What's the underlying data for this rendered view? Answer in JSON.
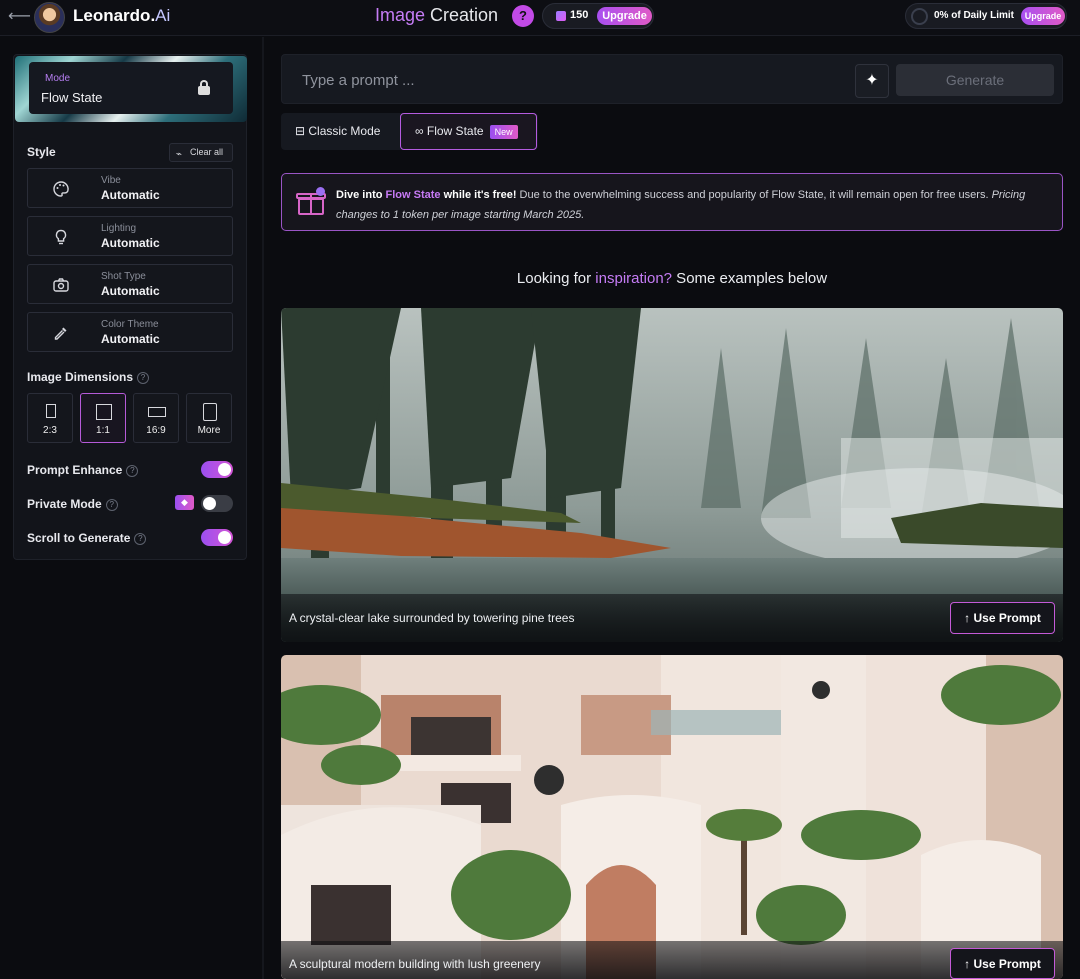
{
  "header": {
    "back_glyph": "⟵",
    "logo_main": "Leonardo.",
    "logo_suffix": "Ai",
    "title_part1": "Image",
    "title_part2": " Creation",
    "help_glyph": "?",
    "tokens": "150",
    "upgrade_label": "Upgrade",
    "daily_limit": "0% of Daily Limit",
    "upgrade_label_2": "Upgrade"
  },
  "sidebar": {
    "mode_label": "Mode",
    "mode_value": "Flow State",
    "style_heading": "Style",
    "clear_all": "Clear all",
    "style_rows": [
      {
        "label": "Vibe",
        "value": "Automatic",
        "icon": "palette-icon"
      },
      {
        "label": "Lighting",
        "value": "Automatic",
        "icon": "lightbulb-icon"
      },
      {
        "label": "Shot Type",
        "value": "Automatic",
        "icon": "camera-icon"
      },
      {
        "label": "Color Theme",
        "value": "Automatic",
        "icon": "eyedropper-icon"
      }
    ],
    "dimensions_heading": "Image Dimensions",
    "dimensions": [
      {
        "label": "2:3"
      },
      {
        "label": "1:1"
      },
      {
        "label": "16:9"
      },
      {
        "label": "More"
      }
    ],
    "selected_dimension": "1:1",
    "toggles": [
      {
        "label": "Prompt Enhance",
        "state": "on"
      },
      {
        "label": "Private Mode",
        "state": "off"
      },
      {
        "label": "Scroll to Generate",
        "state": "on"
      }
    ]
  },
  "prompt": {
    "placeholder": "Type a prompt ...",
    "value": "",
    "generate_label": "Generate"
  },
  "mode_tabs": {
    "classic": "Classic Mode",
    "flow": "Flow State",
    "new_badge": "New"
  },
  "banner": {
    "lead": "Dive into ",
    "accent": "Flow State",
    "lead_end": " while it's free!",
    "body": " Due to the overwhelming success and popularity of Flow State, it will remain open for free users. ",
    "italic": "Pricing changes to 1 token per image starting March 2025."
  },
  "inspiration": {
    "before": "Looking for ",
    "accent": "inspiration?",
    "after": " Some examples below"
  },
  "examples": [
    {
      "caption": "A crystal-clear lake surrounded by towering pine trees",
      "button": "Use Prompt"
    },
    {
      "caption": "A sculptural modern building with lush greenery",
      "button": "Use Prompt"
    }
  ],
  "colors": {
    "accent": "#c57cf5",
    "background": "#0b0c10",
    "panel": "#12141a"
  }
}
